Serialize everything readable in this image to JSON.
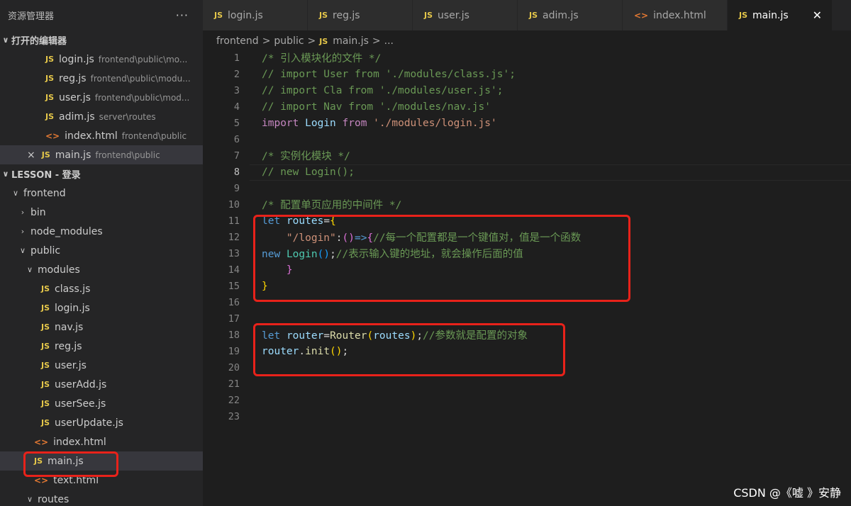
{
  "explorer": {
    "title": "资源管理器",
    "more": "···",
    "open_editors_header": "打开的编辑器",
    "open_editors": [
      {
        "name": "login.js",
        "path": "frontend\\public\\mo...",
        "type": "js"
      },
      {
        "name": "reg.js",
        "path": "frontend\\public\\modu...",
        "type": "js"
      },
      {
        "name": "user.js",
        "path": "frontend\\public\\mod...",
        "type": "js"
      },
      {
        "name": "adim.js",
        "path": "server\\routes",
        "type": "js"
      },
      {
        "name": "index.html",
        "path": "frontend\\public",
        "type": "html"
      },
      {
        "name": "main.js",
        "path": "frontend\\public",
        "type": "js",
        "close": "×"
      }
    ],
    "workspace_header": "LESSON - 登录",
    "tree": {
      "frontend": "frontend",
      "bin": "bin",
      "node_modules": "node_modules",
      "public": "public",
      "modules": "modules",
      "module_files": [
        "class.js",
        "login.js",
        "nav.js",
        "reg.js",
        "user.js",
        "userAdd.js",
        "userSee.js",
        "userUpdate.js"
      ],
      "index_html": "index.html",
      "main_js": "main.js",
      "text_html": "text.html",
      "routes": "routes"
    },
    "icons": {
      "js": "JS",
      "html": "<>"
    }
  },
  "tabs": [
    {
      "label": "login.js",
      "type": "js"
    },
    {
      "label": "reg.js",
      "type": "js"
    },
    {
      "label": "user.js",
      "type": "js"
    },
    {
      "label": "adim.js",
      "type": "js"
    },
    {
      "label": "index.html",
      "type": "html"
    },
    {
      "label": "main.js",
      "type": "js",
      "active": true,
      "close": "✕"
    }
  ],
  "breadcrumb": {
    "part1": "frontend",
    "part2": "public",
    "file": "main.js",
    "tail": "...",
    "sep": ">"
  },
  "editor": {
    "current_line": 8,
    "lines": [
      [
        {
          "t": "/* 引入模块化的文件 */",
          "c": "comment"
        }
      ],
      [
        {
          "t": "// import User from './modules/class.js';",
          "c": "comment"
        }
      ],
      [
        {
          "t": "// import Cla from './modules/user.js';",
          "c": "comment"
        }
      ],
      [
        {
          "t": "// import Nav from './modules/nav.js'",
          "c": "comment"
        }
      ],
      [
        {
          "t": "import",
          "c": "imp"
        },
        {
          "t": " ",
          "c": "punc"
        },
        {
          "t": "Login",
          "c": "var"
        },
        {
          "t": " ",
          "c": "punc"
        },
        {
          "t": "from",
          "c": "imp"
        },
        {
          "t": " ",
          "c": "punc"
        },
        {
          "t": "'./modules/login.js'",
          "c": "str"
        }
      ],
      [],
      [
        {
          "t": "/* 实例化模块 */",
          "c": "comment"
        }
      ],
      [
        {
          "t": "// new Login();",
          "c": "comment"
        }
      ],
      [],
      [
        {
          "t": "/* 配置单页应用的中间件 */",
          "c": "comment"
        }
      ],
      [
        {
          "t": "let",
          "c": "kw"
        },
        {
          "t": " ",
          "c": "punc"
        },
        {
          "t": "routes",
          "c": "var"
        },
        {
          "t": "=",
          "c": "punc"
        },
        {
          "t": "{",
          "c": "br1"
        }
      ],
      [
        {
          "t": "    ",
          "c": "punc"
        },
        {
          "t": "\"/login\"",
          "c": "str"
        },
        {
          "t": ":",
          "c": "punc"
        },
        {
          "t": "()",
          "c": "br2"
        },
        {
          "t": "=>",
          "c": "kw"
        },
        {
          "t": "{",
          "c": "br2"
        },
        {
          "t": "//每一个配置都是一个键值对，值是一个函数",
          "c": "comment"
        }
      ],
      [
        {
          "t": "new",
          "c": "kw"
        },
        {
          "t": " ",
          "c": "punc"
        },
        {
          "t": "Login",
          "c": "cls"
        },
        {
          "t": "()",
          "c": "br3"
        },
        {
          "t": ";",
          "c": "punc"
        },
        {
          "t": "//表示输入键的地址，就会操作后面的值",
          "c": "comment"
        }
      ],
      [
        {
          "t": "    ",
          "c": "punc"
        },
        {
          "t": "}",
          "c": "br2"
        }
      ],
      [
        {
          "t": "}",
          "c": "br1"
        }
      ],
      [],
      [],
      [
        {
          "t": "let",
          "c": "kw"
        },
        {
          "t": " ",
          "c": "punc"
        },
        {
          "t": "router",
          "c": "var"
        },
        {
          "t": "=",
          "c": "punc"
        },
        {
          "t": "Router",
          "c": "fn"
        },
        {
          "t": "(",
          "c": "br1"
        },
        {
          "t": "routes",
          "c": "var"
        },
        {
          "t": ")",
          "c": "br1"
        },
        {
          "t": ";",
          "c": "punc"
        },
        {
          "t": "//参数就是配置的对象",
          "c": "comment"
        }
      ],
      [
        {
          "t": "router",
          "c": "var"
        },
        {
          "t": ".",
          "c": "punc"
        },
        {
          "t": "init",
          "c": "fn"
        },
        {
          "t": "()",
          "c": "br1"
        },
        {
          "t": ";",
          "c": "punc"
        }
      ],
      [],
      [],
      [],
      []
    ]
  },
  "watermark": "CSDN @《嘘 》安静",
  "colors": {
    "highlight_box": "#e8221a",
    "js_icon": "#e6c84a",
    "html_icon": "#e37933"
  }
}
